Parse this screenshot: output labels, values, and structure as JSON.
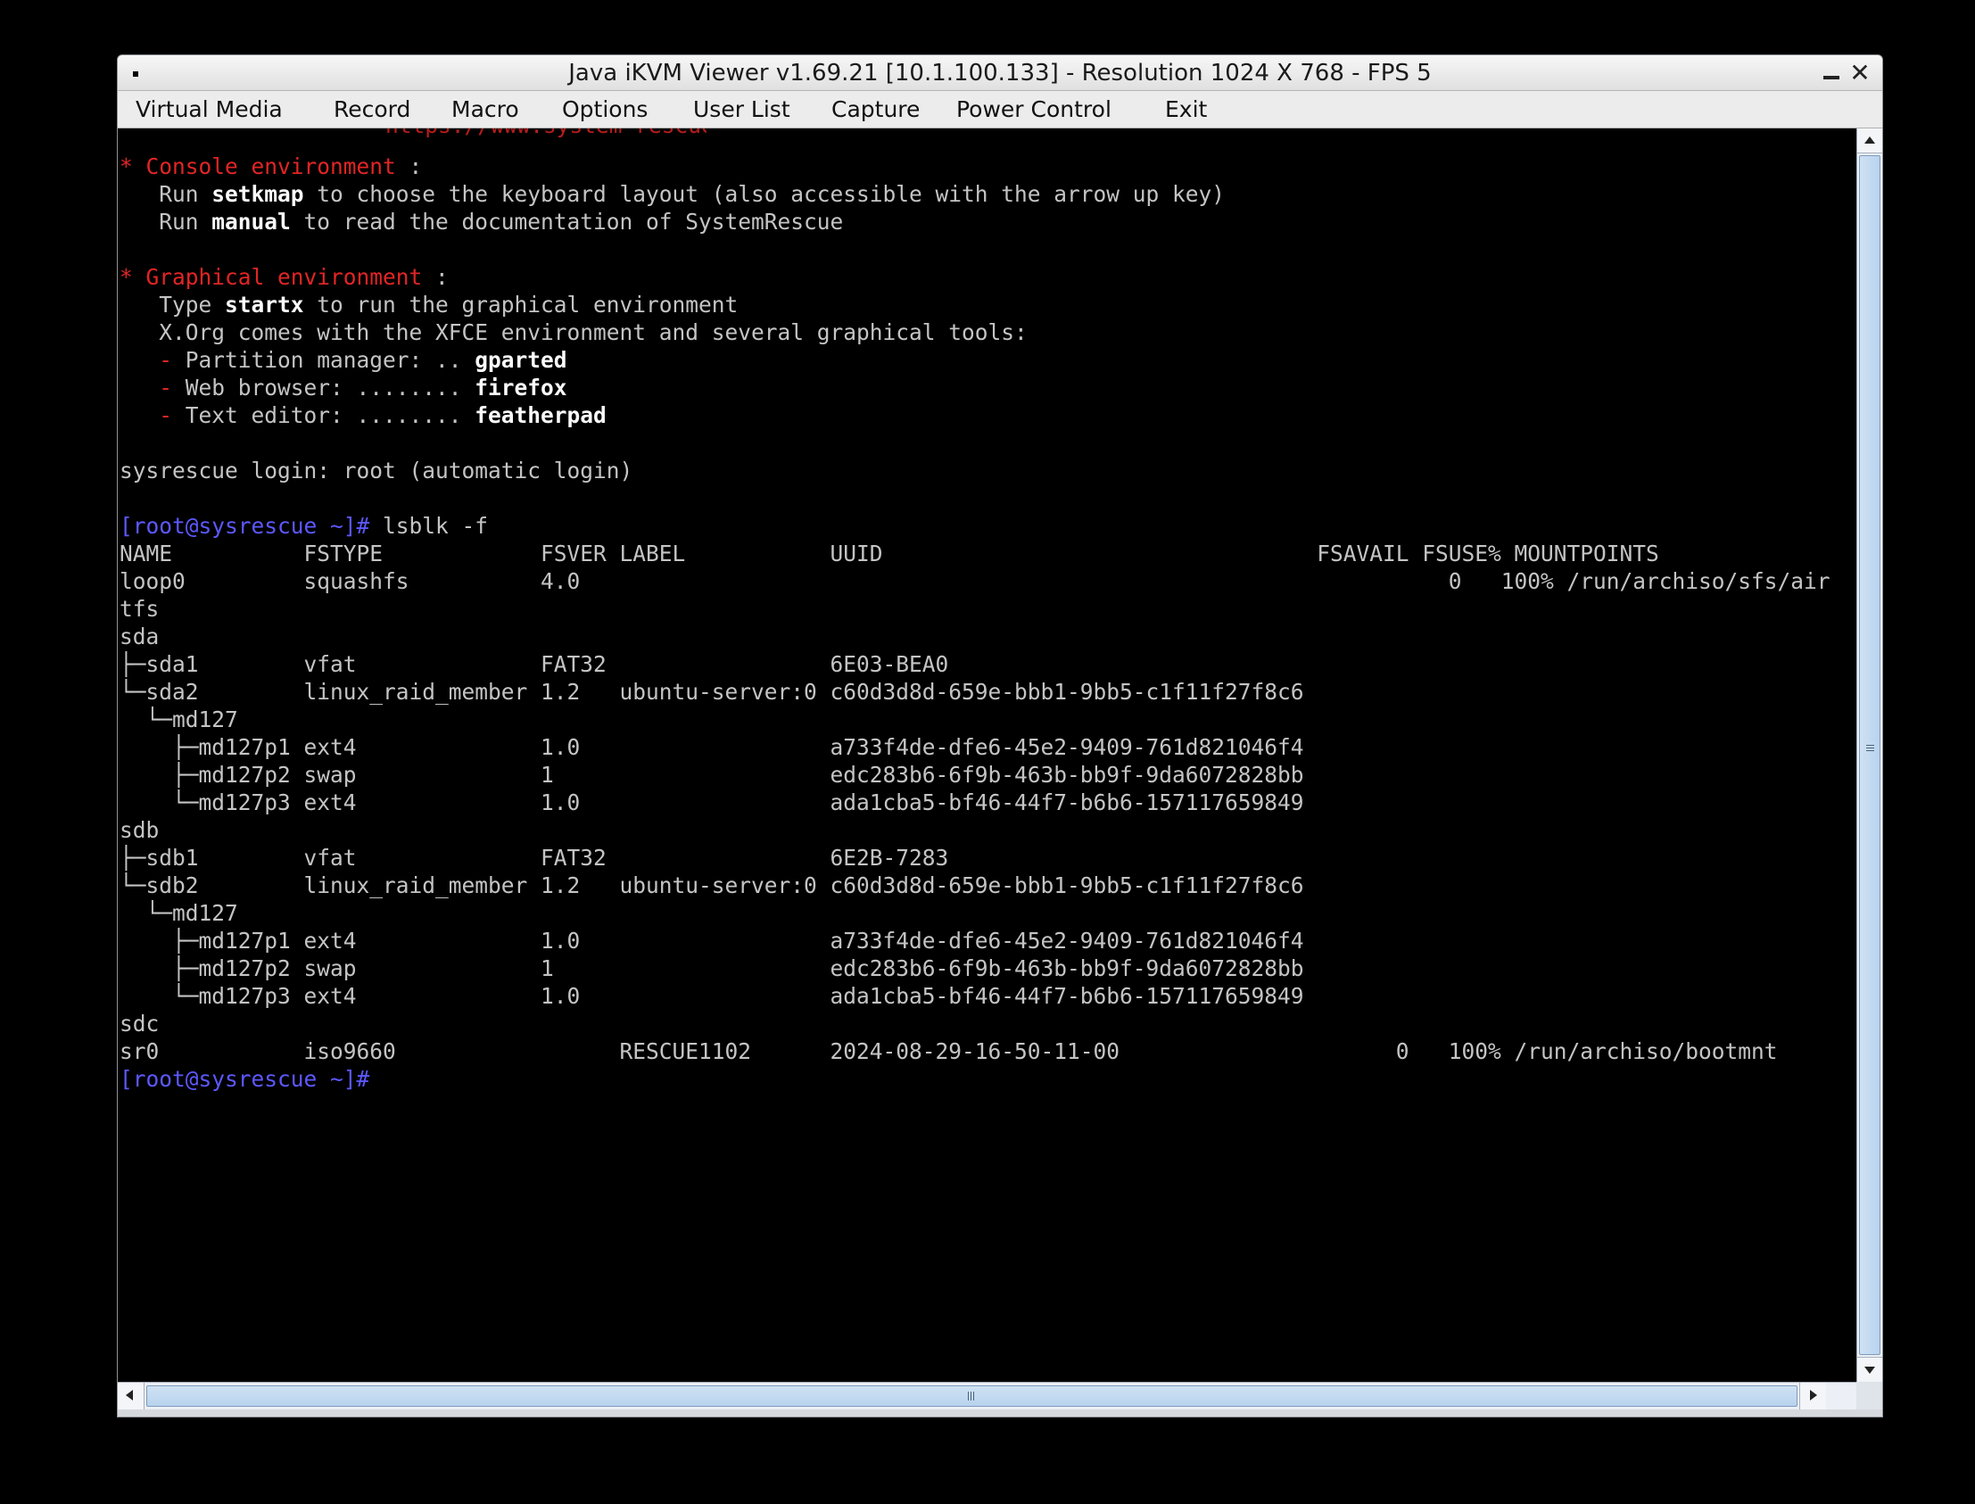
{
  "window": {
    "title": "Java iKVM Viewer v1.69.21 [10.1.100.133] - Resolution 1024 X 768 - FPS 5",
    "minimize_label": "",
    "close_label": "✕"
  },
  "menu": {
    "items": [
      "Virtual Media",
      "Record",
      "Macro",
      "Options",
      "User List",
      "Capture",
      "Power Control",
      "Exit"
    ]
  },
  "console": {
    "cut_line": "https://www.system-rescue.org/",
    "console_env": {
      "bullet": "*",
      "heading": " Console environment",
      "colon": " :",
      "setkmap": {
        "pre": "   Run ",
        "cmd": "setkmap",
        "post": " to choose the keyboard layout (also accessible with the arrow up key)"
      },
      "manual": {
        "pre": "   Run ",
        "cmd": "manual",
        "post": " to read the documentation of SystemRescue"
      }
    },
    "graphical_env": {
      "bullet": "*",
      "heading": " Graphical environment",
      "colon": " :",
      "startx": {
        "pre": "   Type ",
        "cmd": "startx",
        "post": " to run the graphical environment"
      },
      "xorg": "   X.Org comes with the XFCE environment and several graphical tools:",
      "tools": [
        {
          "dash": "   - ",
          "label": "Partition manager: .. ",
          "cmd": "gparted"
        },
        {
          "dash": "   - ",
          "label": "Web browser: ........ ",
          "cmd": "firefox"
        },
        {
          "dash": "   - ",
          "label": "Text editor: ........ ",
          "cmd": "featherpad"
        }
      ]
    },
    "login": "sysrescue login: root (automatic login)",
    "prompt": "[root@sysrescue ~]#",
    "command": " lsblk -f",
    "lsblk_header": "NAME          FSTYPE            FSVER LABEL           UUID                                 FSAVAIL FSUSE% MOUNTPOINTS",
    "lsblk_rows": [
      "loop0         squashfs          4.0                                                                  0   100% /run/archiso/sfs/air",
      "tfs",
      "sda",
      "├─sda1        vfat              FAT32                 6E03-BEA0",
      "└─sda2        linux_raid_member 1.2   ubuntu-server:0 c60d3d8d-659e-bbb1-9bb5-c1f11f27f8c6",
      "  └─md127",
      "    ├─md127p1 ext4              1.0                   a733f4de-dfe6-45e2-9409-761d821046f4",
      "    ├─md127p2 swap              1                     edc283b6-6f9b-463b-bb9f-9da6072828bb",
      "    └─md127p3 ext4              1.0                   ada1cba5-bf46-44f7-b6b6-157117659849",
      "sdb",
      "├─sdb1        vfat              FAT32                 6E2B-7283",
      "└─sdb2        linux_raid_member 1.2   ubuntu-server:0 c60d3d8d-659e-bbb1-9bb5-c1f11f27f8c6",
      "  └─md127",
      "    ├─md127p1 ext4              1.0                   a733f4de-dfe6-45e2-9409-761d821046f4",
      "    ├─md127p2 swap              1                     edc283b6-6f9b-463b-bb9f-9da6072828bb",
      "    └─md127p3 ext4              1.0                   ada1cba5-bf46-44f7-b6b6-157117659849",
      "sdc",
      "sr0           iso9660                 RESCUE1102      2024-08-29-16-50-11-00                     0   100% /run/archiso/bootmnt"
    ],
    "final_prompt": "[root@sysrescue ~]#"
  }
}
